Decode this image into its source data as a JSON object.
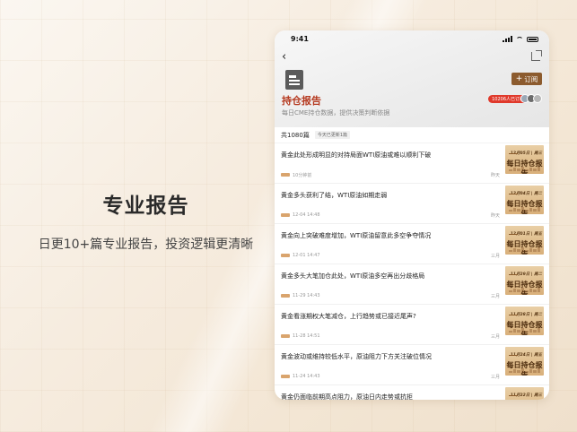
{
  "promo": {
    "title": "专业报告",
    "subtitle": "日更10+篇专业报告，投资逻辑更清晰"
  },
  "status_bar": {
    "time": "9:41"
  },
  "report": {
    "title": "持仓报告",
    "description": "每日CME持仓数据，提供决策判断依据",
    "subscribe_label": "订阅",
    "subscribers_badge": "10206人已订阅"
  },
  "list": {
    "count_label": "共1080篇",
    "update_label": "今天已更新1篇",
    "thumb_label": "每日持仓报告",
    "articles": [
      {
        "title": "黄金此处形成明显的对持局面WTI原油或难以顺利下破",
        "date": "10分钟前",
        "weekday": "昨天",
        "thumb_date": "12月05日 | 周三"
      },
      {
        "title": "黄金多头获利了结，WTI原油如期走弱",
        "date": "12-04 14:48",
        "weekday": "昨天",
        "thumb_date": "12月04日 | 周二"
      },
      {
        "title": "黄金向上突破难度增加，WTI原油留意此多空争夺情况",
        "date": "12-01 14:47",
        "weekday": "三月",
        "thumb_date": "12月01日 | 周五"
      },
      {
        "title": "黄金多头大笔加仓此处，WTI原油多空再出分歧格局",
        "date": "11-29 14:43",
        "weekday": "三月",
        "thumb_date": "11月29日 | 周二"
      },
      {
        "title": "黄金看涨期权大笔减仓，上行趋势或已接近尾声?",
        "date": "11-28 14:51",
        "weekday": "三月",
        "thumb_date": "11月28日 | 周二"
      },
      {
        "title": "黄金波动或维持较低水平，原油阻力下方关注破位情况",
        "date": "11-24 14:43",
        "weekday": "三月",
        "thumb_date": "11月24日 | 周五"
      },
      {
        "title": "黄金仍面临前期高点阻力，原油日内走势或抗拒",
        "date": "",
        "weekday": "",
        "thumb_date": "11月22日 | 周三"
      }
    ]
  },
  "colors": {
    "accent_red": "#b5391f",
    "subscribe_brown": "#8c5b2e",
    "badge_red": "#e0392b"
  },
  "icons": [
    "back-icon",
    "share-icon",
    "report-logo-icon",
    "signal-icon",
    "wifi-icon",
    "battery-icon"
  ]
}
